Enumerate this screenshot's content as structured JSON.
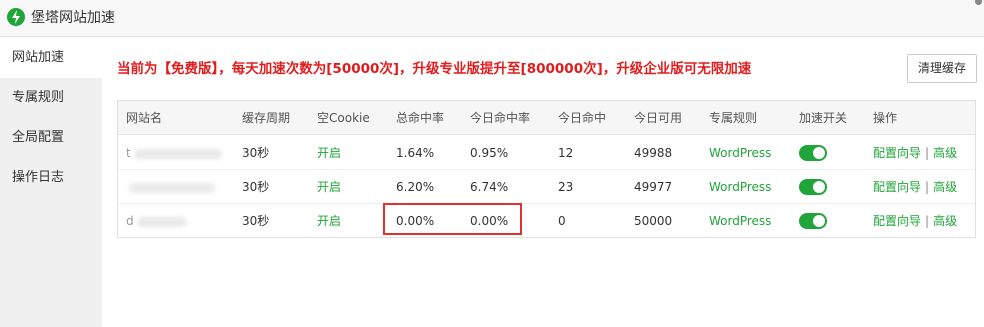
{
  "window": {
    "title": "堡塔网站加速",
    "logo_icon": "lightning-icon",
    "brand_color": "#20a53a"
  },
  "sidebar": {
    "items": [
      {
        "label": "网站加速",
        "active": true
      },
      {
        "label": "专属规则",
        "active": false
      },
      {
        "label": "全局配置",
        "active": false
      },
      {
        "label": "操作日志",
        "active": false
      }
    ]
  },
  "notice": "当前为【免费版】，每天加速次数为[50000次]，升级专业版提升至[800000次]，升级企业版可无限加速",
  "clear_cache_button": "清理缓存",
  "table": {
    "headers": [
      "网站名",
      "缓存周期",
      "空Cookie",
      "总命中率",
      "今日命中率",
      "今日命中",
      "今日可用",
      "专属规则",
      "加速开关",
      "操作"
    ],
    "rows": [
      {
        "site": "t",
        "cache_period": "30秒",
        "cookie": "开启",
        "total_hit_rate": "1.64%",
        "today_hit_rate": "0.95%",
        "today_hits": "12",
        "today_available": "49988",
        "rule": "WordPress",
        "switch_on": true,
        "op_wizard": "配置向导",
        "op_sep": "|",
        "op_advanced": "高级"
      },
      {
        "site": "",
        "cache_period": "30秒",
        "cookie": "开启",
        "total_hit_rate": "6.20%",
        "today_hit_rate": "6.74%",
        "today_hits": "23",
        "today_available": "49977",
        "rule": "WordPress",
        "switch_on": true,
        "op_wizard": "配置向导",
        "op_sep": "|",
        "op_advanced": "高级"
      },
      {
        "site": "d",
        "cache_period": "30秒",
        "cookie": "开启",
        "total_hit_rate": "0.00%",
        "today_hit_rate": "0.00%",
        "today_hits": "0",
        "today_available": "50000",
        "rule": "WordPress",
        "switch_on": true,
        "op_wizard": "配置向导",
        "op_sep": "|",
        "op_advanced": "高级"
      }
    ]
  },
  "highlight_color": "#e0312f"
}
